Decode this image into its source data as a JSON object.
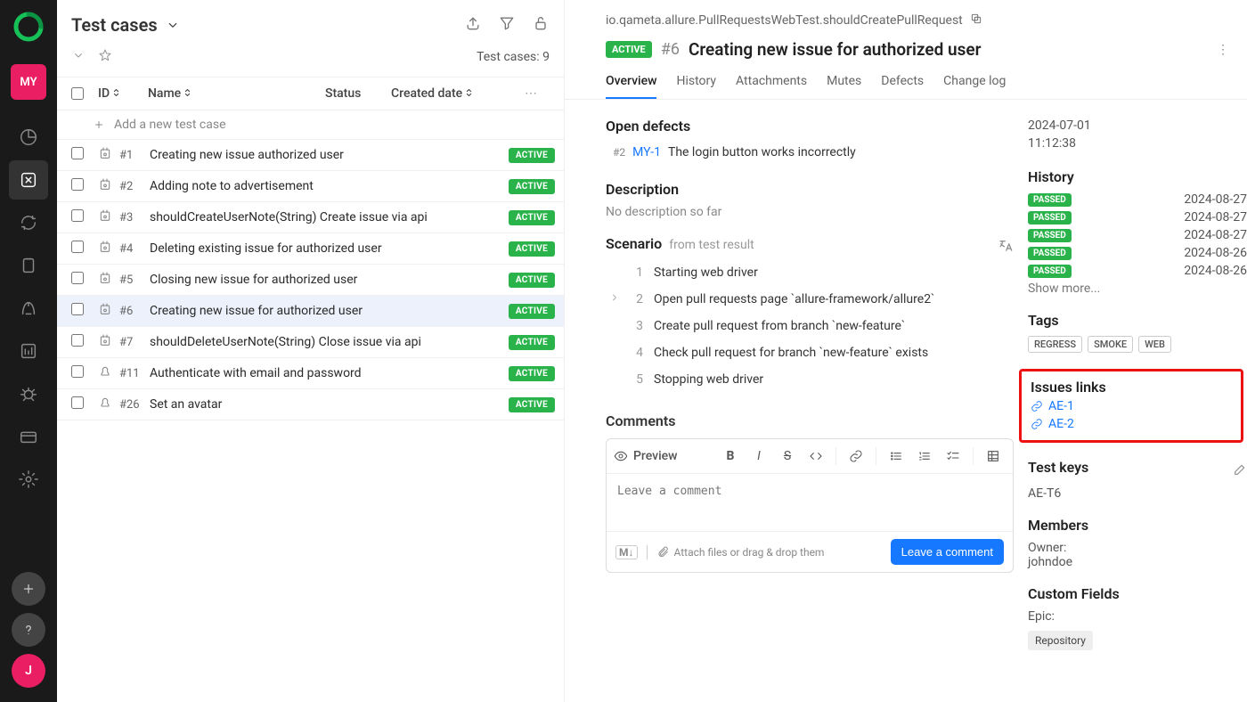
{
  "rail": {
    "workspace_initials": "MY",
    "user_initial": "J"
  },
  "left": {
    "title": "Test cases",
    "count_label": "Test cases: 9",
    "columns": {
      "id": "ID",
      "name": "Name",
      "status": "Status",
      "created": "Created date"
    },
    "add_placeholder": "Add a new test case",
    "rows": [
      {
        "num": "#1",
        "title": "Creating new issue authorized user",
        "badge": "ACTIVE",
        "manual": false
      },
      {
        "num": "#2",
        "title": "Adding note to advertisement",
        "badge": "ACTIVE",
        "manual": false
      },
      {
        "num": "#3",
        "title": "shouldCreateUserNote(String) Create issue via api",
        "badge": "ACTIVE",
        "manual": false
      },
      {
        "num": "#4",
        "title": "Deleting existing issue for authorized user",
        "badge": "ACTIVE",
        "manual": false
      },
      {
        "num": "#5",
        "title": "Closing new issue for authorized user",
        "badge": "ACTIVE",
        "manual": false
      },
      {
        "num": "#6",
        "title": "Creating new issue for authorized user",
        "badge": "ACTIVE",
        "selected": true,
        "manual": false
      },
      {
        "num": "#7",
        "title": "shouldDeleteUserNote(String) Close issue via api",
        "badge": "ACTIVE",
        "manual": false
      },
      {
        "num": "#11",
        "title": "Authenticate with email and password",
        "badge": "ACTIVE",
        "manual": true
      },
      {
        "num": "#26",
        "title": "Set an avatar",
        "badge": "ACTIVE",
        "manual": true
      }
    ]
  },
  "detail": {
    "crumb": "io.qameta.allure.PullRequestsWebTest.shouldCreatePullRequest",
    "status_badge": "ACTIVE",
    "hash": "#6",
    "title": "Creating new issue for authorized user",
    "tabs": [
      "Overview",
      "History",
      "Attachments",
      "Mutes",
      "Defects",
      "Change log"
    ],
    "active_tab": 0,
    "defects_h": "Open defects",
    "defect": {
      "num": "#2",
      "key": "MY-1",
      "text": "The login button works incorrectly"
    },
    "description_h": "Description",
    "description_empty": "No description so far",
    "scenario_h": "Scenario",
    "scenario_sub": "from test result",
    "steps": [
      "Starting web driver",
      "Open pull requests page `allure-framework/allure2`",
      "Create pull request from branch `new-feature`",
      "Check pull request for branch `new-feature` exists",
      "Stopping web driver"
    ],
    "comments_h": "Comments",
    "preview_label": "Preview",
    "textarea_placeholder": "Leave a comment",
    "attach_hint": "Attach files or drag & drop them",
    "submit_label": "Leave a comment",
    "md_label": "M↓"
  },
  "side": {
    "created_date": "2024-07-01",
    "created_time": "11:12:38",
    "history_h": "History",
    "history": [
      {
        "status": "PASSED",
        "date": "2024-08-27"
      },
      {
        "status": "PASSED",
        "date": "2024-08-27"
      },
      {
        "status": "PASSED",
        "date": "2024-08-27"
      },
      {
        "status": "PASSED",
        "date": "2024-08-26"
      },
      {
        "status": "PASSED",
        "date": "2024-08-26"
      }
    ],
    "show_more": "Show more...",
    "tags_h": "Tags",
    "tags": [
      "REGRESS",
      "SMOKE",
      "WEB"
    ],
    "issues_h": "Issues links",
    "issues": [
      "AE-1",
      "AE-2"
    ],
    "testkeys_h": "Test keys",
    "testkey": "AE-T6",
    "members_h": "Members",
    "owner_label": "Owner:",
    "owner_val": "johndoe",
    "custom_h": "Custom Fields",
    "epic_label": "Epic:",
    "repo_tag": "Repository"
  }
}
